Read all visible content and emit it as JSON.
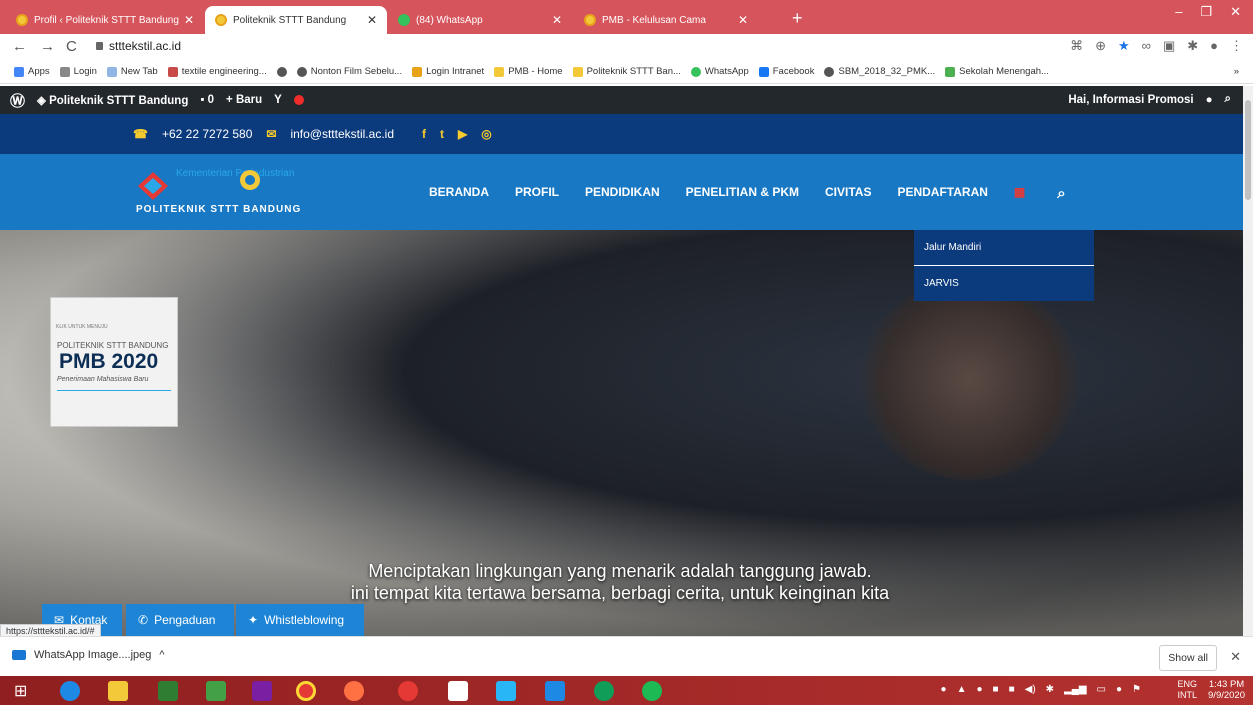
{
  "tabs": [
    {
      "title": "Profil ‹ Politeknik STTT Bandung",
      "active": false
    },
    {
      "title": "Politeknik STTT Bandung",
      "active": true
    },
    {
      "title": "(84) WhatsApp",
      "active": false
    },
    {
      "title": "PMB - Kelulusan Cama",
      "active": false
    }
  ],
  "address_bar": {
    "url": "stttekstil.ac.id"
  },
  "bookmarks": [
    "Apps",
    "Login",
    "New Tab",
    "textile engineering...",
    "Nonton Film Sebelu...",
    "Login Intranet",
    "PMB - Home",
    "Politeknik STTT Ban...",
    "WhatsApp",
    "Facebook",
    "SBM_2018_32_PMK...",
    "Sekolah Menengah..."
  ],
  "wp_admin": {
    "site": "Politeknik STTT Bandung",
    "comments": "0",
    "new": "Baru",
    "greeting": "Hai, Informasi Promosi"
  },
  "contact": {
    "phone": "+62 22 7272 580",
    "email": "info@stttekstil.ac.id"
  },
  "logo": {
    "ministry": "Kementerian Perindustrian",
    "name": "POLITEKNIK STTT BANDUNG"
  },
  "nav": [
    "BERANDA",
    "PROFIL",
    "PENDIDIKAN",
    "PENELITIAN & PKM",
    "CIVITAS",
    "PENDAFTARAN"
  ],
  "dropdown": [
    "Jalur Mandiri",
    "JARVIS"
  ],
  "pmb_card": {
    "small": "KLIK UNTUK MENUJU",
    "inst": "POLITEKNIK STTT BANDUNG",
    "title": "PMB 2020",
    "subtitle": "Penerimaan Mahasiswa Baru"
  },
  "hero_caption": [
    "Menciptakan lingkungan yang menarik adalah tanggung jawab.",
    "ini tempat kita tertawa bersama, berbagi cerita, untuk keinginan kita"
  ],
  "floating_buttons": [
    "Kontak",
    "Pengaduan",
    "Whistleblowing"
  ],
  "status_url": "https://stttekstil.ac.id/#",
  "download": {
    "file": "WhatsApp Image....jpeg",
    "show_all": "Show all"
  },
  "taskbar": {
    "lang1": "ENG",
    "lang2": "INTL",
    "time": "1:43 PM",
    "date": "9/9/2020"
  },
  "colors": {
    "tab_strip": "#d6545c",
    "topbar": "#0c3b7d",
    "header": "#1878c4",
    "accent_yellow": "#f6cb2d"
  }
}
